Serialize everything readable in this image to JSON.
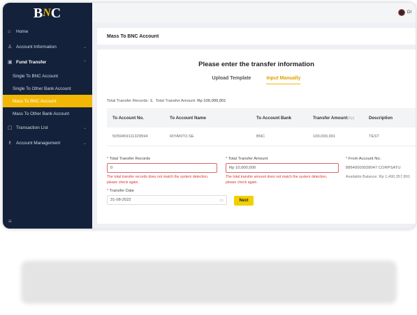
{
  "brand": {
    "logo_b": "B",
    "logo_n": "N",
    "logo_c": "C"
  },
  "sidebar": {
    "items": [
      {
        "label": "Home",
        "icon": "home-icon",
        "glyph": "⌂"
      },
      {
        "label": "Account Information",
        "icon": "user-icon",
        "glyph": "♙",
        "chevron": "⌄"
      },
      {
        "label": "Fund Transfer",
        "icon": "transfer-icon",
        "glyph": "▣",
        "chevron": "⌃"
      },
      {
        "label": "Transaction List",
        "icon": "list-icon",
        "glyph": "▢",
        "chevron": "⌄"
      },
      {
        "label": "Account Management",
        "icon": "users-icon",
        "glyph": "♗",
        "chevron": "⌄"
      }
    ],
    "fund_transfer_sub": [
      {
        "label": "Single To BNC Account"
      },
      {
        "label": "Single To Other Bank Account"
      },
      {
        "label": "Mass To BNC Account",
        "active": true
      },
      {
        "label": "Mass To Other Bank Account"
      }
    ],
    "collapse_glyph": "≡"
  },
  "topbar": {
    "user_label": "DI"
  },
  "page": {
    "title": "Mass To BNC Account"
  },
  "card": {
    "heading": "Please enter the transfer information",
    "tabs": [
      {
        "label": "Upload Template"
      },
      {
        "label": "Input Manually",
        "active": true
      }
    ],
    "summary": {
      "records_label": "Total Transfer Records:",
      "records_value": "1;",
      "amount_label": "Total Transfer Amount:",
      "amount_value": "Rp 100,000,001"
    },
    "table": {
      "headers": [
        "To Account No.",
        "To Account Name",
        "To Account Bank",
        "Transfer Amount",
        "Description"
      ],
      "amount_unit": "(Rp)",
      "rows": [
        [
          "5059459111329594",
          "RIYANTO.SE",
          "BNC",
          "100,000,001",
          "TEST"
        ]
      ]
    },
    "form": {
      "records": {
        "required": "*",
        "label": "Total Transfer Records",
        "value": "0",
        "error": "The total transfer records does not match the system detection, please check again."
      },
      "amount": {
        "required": "*",
        "label": "Total Transfer Amount",
        "value": "Rp 10,000,000",
        "error": "The total transfer amount does not match the system detection, please check again."
      },
      "from_account": {
        "required": "*",
        "label": "From Account No.",
        "value": "88640000028047 CORPSATU",
        "balance_label": "Available Balance:",
        "balance_value": "Rp 1,490,357,891"
      },
      "date": {
        "required": "*",
        "label": "Transfer Date",
        "value": "31-08-2022",
        "icon_glyph": "▭"
      },
      "next_label": "Next"
    }
  },
  "colors": {
    "sidebar_bg": "#13213b",
    "accent": "#f2b705",
    "error": "#d33333",
    "button": "#f2d000"
  }
}
